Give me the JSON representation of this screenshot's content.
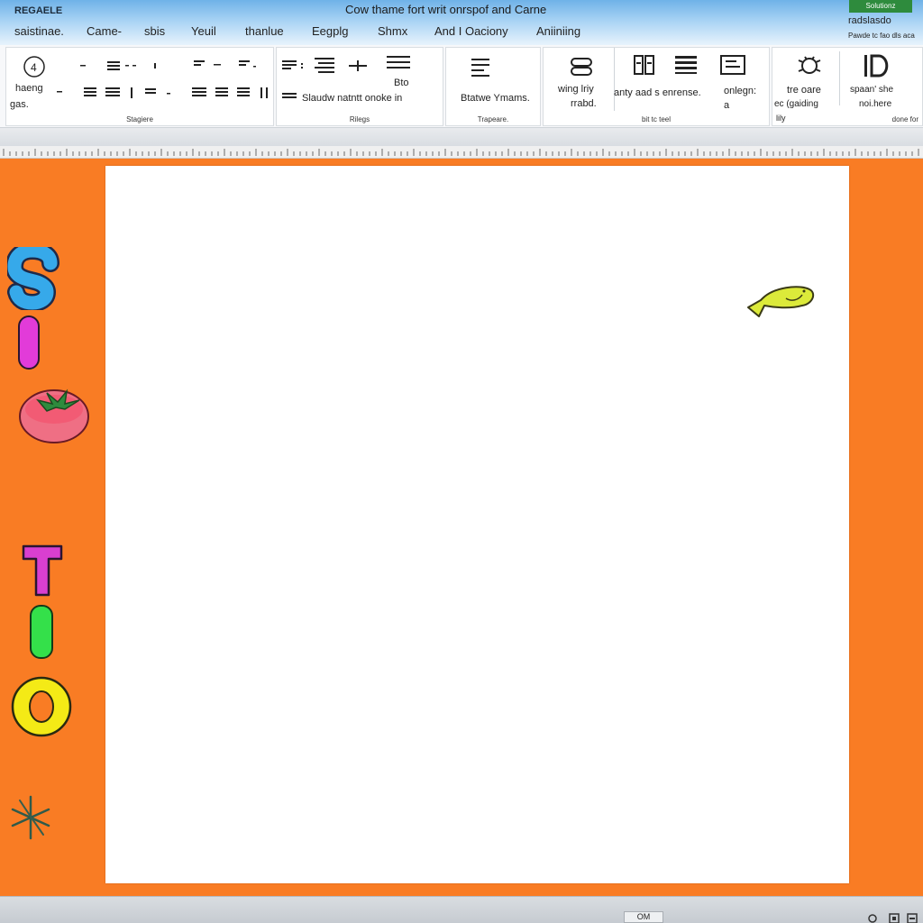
{
  "titlebar": {
    "app_name": "REGAELE",
    "document_title": "Cow thame fort writ onrspof and Carne",
    "account_button": "Solutionz",
    "right_text_1": "radslasdo",
    "right_text_2": "Pawde tc fao dls aca"
  },
  "tabs": [
    {
      "label": "saistinae."
    },
    {
      "label": "Came-"
    },
    {
      "label": "sbis"
    },
    {
      "label": "Yeuil"
    },
    {
      "label": "thanlue"
    },
    {
      "label": "Eegplg"
    },
    {
      "label": "Shmx"
    },
    {
      "label": "And I Oaciony"
    },
    {
      "label": "Aniiniing"
    }
  ],
  "ribbon": {
    "group1": {
      "label": "Stagiere",
      "line1": "haeng",
      "line2": "gas.",
      "icons": [
        "circle-number-icon",
        "align-left-icon",
        "align-center-icon",
        "bullets-icon",
        "justify-icon"
      ]
    },
    "group2": {
      "label": "Rilegs",
      "text_top": "Bto",
      "text_main": "Slaudw natntt onoke in",
      "icons": [
        "list-icon",
        "indent-icon",
        "plus-icon",
        "table-icon"
      ]
    },
    "group3": {
      "label": "Trapeare.",
      "text": "Btatwe Ymams.",
      "icons": [
        "styles-icon"
      ]
    },
    "group4": {
      "label": "bit tc teel",
      "text1_line1": "wing lriy",
      "text1_line2": "rrabd.",
      "text2": "anty aad s enrense.",
      "text3_line1": "onlegn:",
      "text3_line2": "a",
      "icons": [
        "link-icon",
        "columns-icon",
        "list-lines-icon",
        "frame-icon"
      ]
    },
    "group5": {
      "label": "done for",
      "text1": "tre oare",
      "text2": "ec (gaiding",
      "text3": "spaan' she",
      "text4": "noi.here",
      "text5": "lily",
      "icons": [
        "bug-icon",
        "d-format-icon"
      ]
    }
  },
  "canvas": {
    "page_color": "#ffffff",
    "background_color": "#f97c24",
    "decorations": [
      "letter-s-icon",
      "bar-i-icon",
      "tomato-icon",
      "letter-t-icon",
      "bar-green-icon",
      "letter-o-icon",
      "star-icon",
      "fish-icon"
    ]
  },
  "statusbar": {
    "zoom_label": "OM"
  }
}
